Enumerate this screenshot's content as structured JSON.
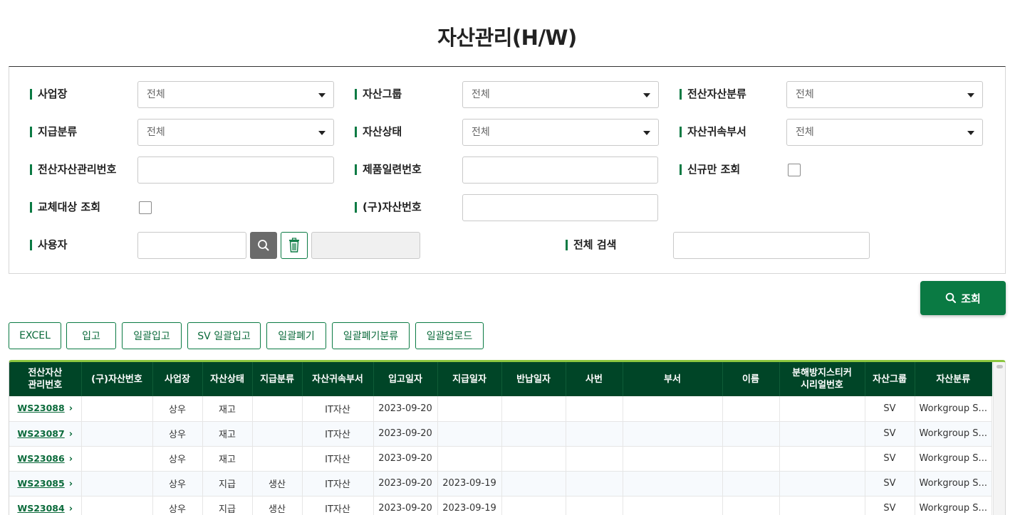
{
  "page": {
    "title": "자산관리(H/W)"
  },
  "filters": {
    "business_site": {
      "label": "사업장",
      "value": "전체"
    },
    "asset_group": {
      "label": "자산그룹",
      "value": "전체"
    },
    "it_asset_class": {
      "label": "전산자산분류",
      "value": "전체"
    },
    "supply_class": {
      "label": "지급분류",
      "value": "전체"
    },
    "asset_status": {
      "label": "자산상태",
      "value": "전체"
    },
    "asset_dept": {
      "label": "자산귀속부서",
      "value": "전체"
    },
    "it_asset_no": {
      "label": "전산자산관리번호",
      "value": ""
    },
    "serial_no": {
      "label": "제품일련번호",
      "value": ""
    },
    "new_only": {
      "label": "신규만 조회",
      "checked": false
    },
    "replace_target": {
      "label": "교체대상 조회",
      "checked": false
    },
    "old_asset_no": {
      "label": "(구)자산번호",
      "value": ""
    },
    "user": {
      "label": "사용자",
      "value": "",
      "name_value": ""
    },
    "full_search": {
      "label": "전체 검색",
      "value": ""
    }
  },
  "buttons": {
    "query": "조회",
    "excel": "EXCEL",
    "receive": "입고",
    "bulk_receive": "일괄입고",
    "sv_bulk_receive": "SV 일괄입고",
    "bulk_dispose": "일괄폐기",
    "bulk_dispose_class": "일괄폐기분류",
    "bulk_upload": "일괄업로드"
  },
  "colors": {
    "primary": "#0a7a43",
    "header": "#004527",
    "accent_bar": "#8cc63f"
  },
  "table": {
    "headers": {
      "asset_no_line1": "전산자산",
      "asset_no_line2": "관리번호",
      "old_no": "(구)자산번호",
      "site": "사업장",
      "status": "자산상태",
      "supply": "지급분류",
      "dept": "자산귀속부서",
      "in_date": "입고일자",
      "supply_date": "지급일자",
      "return_date": "반납일자",
      "emp_no": "사번",
      "department": "부서",
      "name": "이름",
      "sticker_line1": "분해방지스티커",
      "sticker_line2": "시리얼번호",
      "group": "자산그룹",
      "asset_class": "자산분류"
    },
    "rows": [
      {
        "asset_no": "WS23088",
        "old_no": "",
        "site": "상우",
        "status": "재고",
        "supply": "",
        "dept": "IT자산",
        "in_date": "2023-09-20",
        "supply_date": "",
        "return_date": "",
        "emp_no": "",
        "department": "",
        "name": "",
        "sticker": "",
        "group": "SV",
        "asset_class": "Workgroup S..."
      },
      {
        "asset_no": "WS23087",
        "old_no": "",
        "site": "상우",
        "status": "재고",
        "supply": "",
        "dept": "IT자산",
        "in_date": "2023-09-20",
        "supply_date": "",
        "return_date": "",
        "emp_no": "",
        "department": "",
        "name": "",
        "sticker": "",
        "group": "SV",
        "asset_class": "Workgroup S..."
      },
      {
        "asset_no": "WS23086",
        "old_no": "",
        "site": "상우",
        "status": "재고",
        "supply": "",
        "dept": "IT자산",
        "in_date": "2023-09-20",
        "supply_date": "",
        "return_date": "",
        "emp_no": "",
        "department": "",
        "name": "",
        "sticker": "",
        "group": "SV",
        "asset_class": "Workgroup S..."
      },
      {
        "asset_no": "WS23085",
        "old_no": "",
        "site": "상우",
        "status": "지급",
        "supply": "생산",
        "dept": "IT자산",
        "in_date": "2023-09-20",
        "supply_date": "2023-09-19",
        "return_date": "",
        "emp_no": "",
        "department": "",
        "name": "",
        "sticker": "",
        "group": "SV",
        "asset_class": "Workgroup S..."
      },
      {
        "asset_no": "WS23084",
        "old_no": "",
        "site": "상우",
        "status": "지급",
        "supply": "생산",
        "dept": "IT자산",
        "in_date": "2023-09-20",
        "supply_date": "2023-09-19",
        "return_date": "",
        "emp_no": "",
        "department": "",
        "name": "",
        "sticker": "",
        "group": "SV",
        "asset_class": "Workgroup S..."
      }
    ]
  }
}
